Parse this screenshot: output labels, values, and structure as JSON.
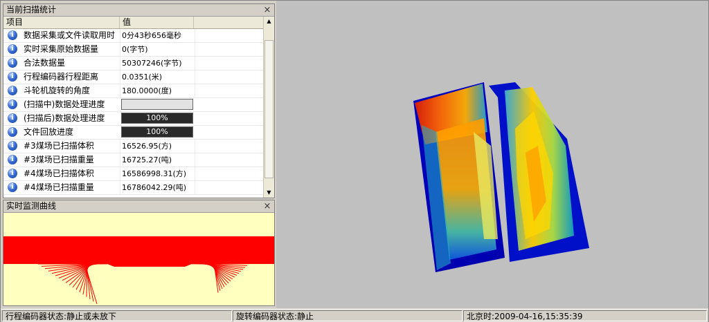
{
  "stats_panel": {
    "title": "当前扫描统计",
    "close": "×",
    "col_item": "项目",
    "col_value": "值",
    "rows": [
      {
        "label": "数据采集或文件读取用时",
        "value": "0分43秒656毫秒"
      },
      {
        "label": "实时采集原始数据量",
        "value": "0(字节)"
      },
      {
        "label": "合法数据量",
        "value": "50307246(字节)"
      },
      {
        "label": "行程编码器行程距离",
        "value": "0.0351(米)"
      },
      {
        "label": "斗轮机旋转的角度",
        "value": "180.0000(度)"
      },
      {
        "label": "(扫描中)数据处理进度",
        "value": ""
      },
      {
        "label": "(扫描后)数据处理进度",
        "value": "100%"
      },
      {
        "label": "文件回放进度",
        "value": "100%"
      },
      {
        "label": "#3煤场已扫描体积",
        "value": "16526.95(方)"
      },
      {
        "label": "#3煤场已扫描重量",
        "value": "16725.27(吨)"
      },
      {
        "label": "#4煤场已扫描体积",
        "value": "16586998.31(方)"
      },
      {
        "label": "#4煤场已扫描重量",
        "value": "16786042.29(吨)"
      }
    ],
    "progress": {
      "scanning": 0,
      "after_scan": 1.0,
      "playback": 1.0
    }
  },
  "curve_panel": {
    "title": "实时监测曲线",
    "close": "×"
  },
  "status_bar": {
    "travel_encoder": "行程编码器状态:静止或未放下",
    "rotation_encoder": "旋转编码器状态:静止",
    "clock": "北京时:2009-04-16,15:35:39"
  },
  "colors": {
    "curve_background": "#ffffc0",
    "curve_lines": "#ff0000",
    "view_background": "#c0c0c0"
  }
}
